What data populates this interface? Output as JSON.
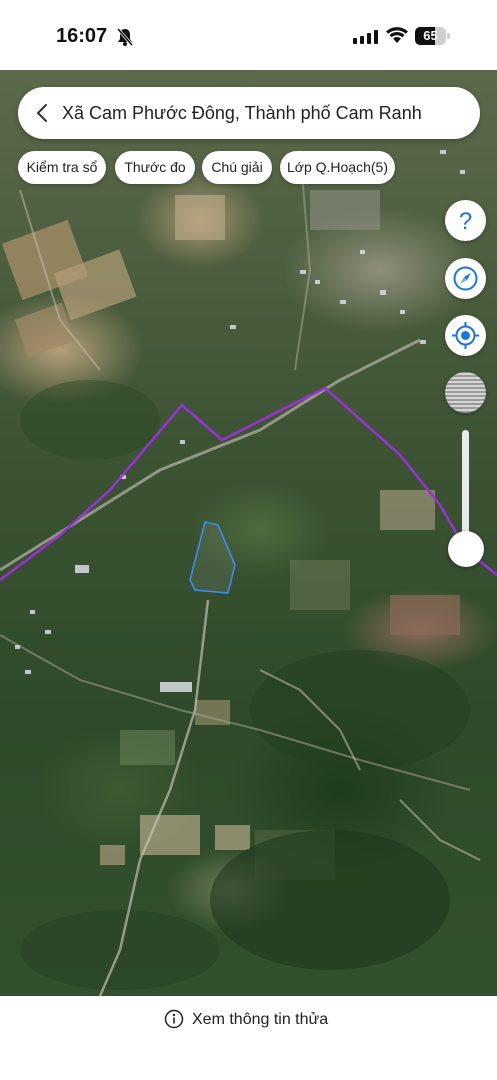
{
  "status_bar": {
    "time": "16:07",
    "battery_level": "65",
    "battery_fraction": 0.65,
    "icons": [
      "bell-muted-icon",
      "signal-icon",
      "wifi-icon",
      "battery-icon"
    ]
  },
  "header": {
    "title": "Xã Cam Phước Đông, Thành phố Cam Ranh",
    "back_icon": "chevron-left-icon"
  },
  "chips": [
    {
      "label": "Kiểm tra sổ"
    },
    {
      "label": "Thước đo"
    },
    {
      "label": "Chú giải"
    },
    {
      "label": "Lớp Q.Hoạch(5)"
    }
  ],
  "controls": {
    "help_icon": "question-icon",
    "compass_icon": "compass-icon",
    "location_icon": "crosshair-icon",
    "opacity_icon": "layer-opacity-icon"
  },
  "colors": {
    "accent": "#1a73e8",
    "boundary": "#9b30d9",
    "parcel_outline": "#3a8df0"
  },
  "bottom": {
    "info_text": "Xem thông tin thửa",
    "info_icon": "info-icon"
  }
}
